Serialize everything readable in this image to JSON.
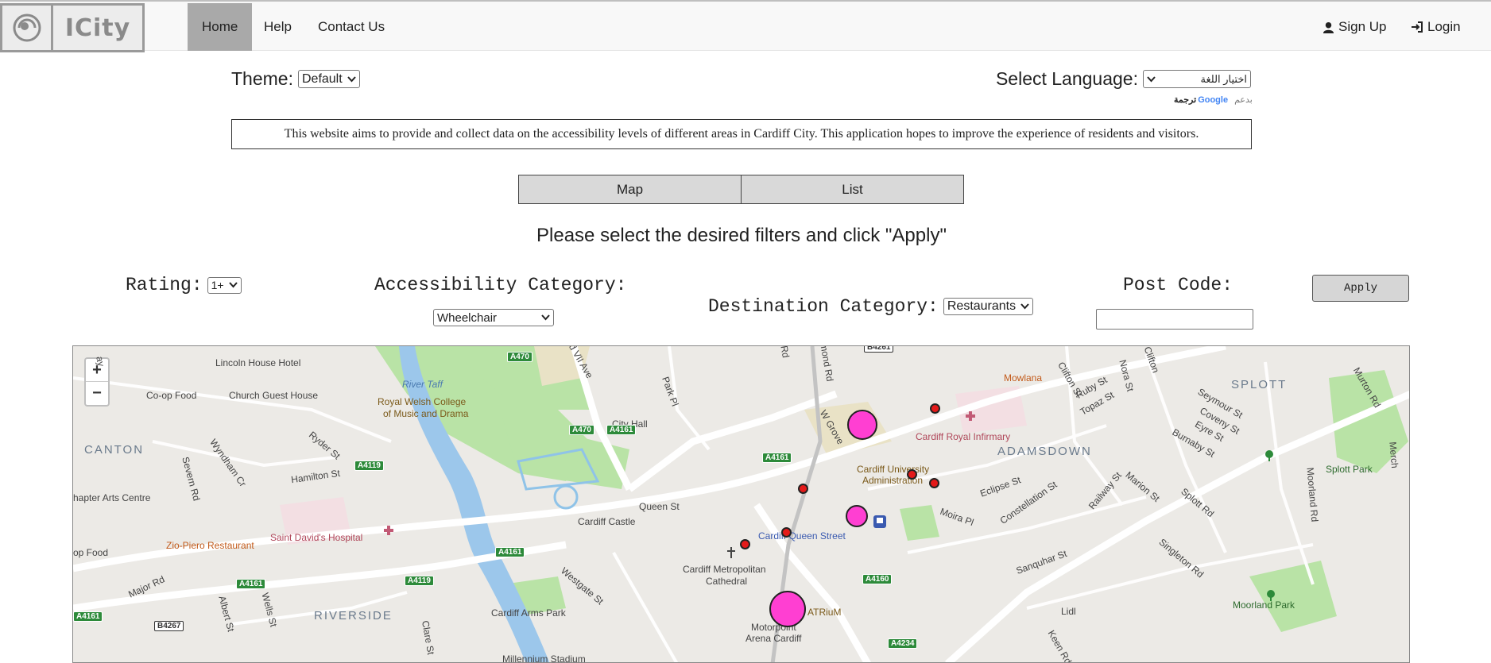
{
  "nav": {
    "logo_text": "ICity",
    "items": [
      {
        "label": "Home",
        "active": true
      },
      {
        "label": "Help"
      },
      {
        "label": "Contact Us"
      }
    ],
    "signup": "Sign Up",
    "login": "Login"
  },
  "theme": {
    "label": "Theme:",
    "value": "Default"
  },
  "language": {
    "label": "Select Language:",
    "value": "اختيار اللغة",
    "powered": "بدعم",
    "google": "Google",
    "translate": "ترجمة"
  },
  "banner": "This website aims to provide and collect data on the accessibility levels of different areas in Cardiff City. This application hopes to improve the experience of residents and visitors.",
  "view_toggle": {
    "map": "Map",
    "list": "List"
  },
  "instructions": "Please select the desired filters and click \"Apply\"",
  "filters": {
    "rating_label": "Rating:",
    "rating_value": "1+",
    "accessibility_label": "Accessibility Category:",
    "accessibility_value": "Wheelchair",
    "destination_label": "Destination Category:",
    "destination_value": "Restaurants",
    "postcode_label": "Post Code:",
    "postcode_value": "",
    "apply": "Apply"
  },
  "map": {
    "zoom_in": "+",
    "zoom_out": "−",
    "areas": [
      "CANTON",
      "RIVERSIDE",
      "ADAMSDOWN",
      "SPLOTT"
    ],
    "places": {
      "lincoln": "Lincoln House Hotel",
      "coop": "Co-op Food",
      "church": "Church Guest House",
      "chapter": "hapter Arts Centre",
      "zio": "Zio-Piero Restaurant",
      "stdavids": "Saint David's Hospital",
      "coop2": "op Food",
      "rwcmd1": "Royal Welsh College",
      "rwcmd2": "of Music and Drama",
      "cityhall": "City Hall",
      "rivertaff": "River Taff",
      "castle": "Cardiff Castle",
      "armspark": "Cardiff Arms Park",
      "millennium": "Millennium Stadium",
      "metro1": "Cardiff Metropolitan",
      "metro2": "Cathedral",
      "queenst_station": "Cardiff Queen Street",
      "motorpoint1": "Motorpoint",
      "motorpoint2": "Arena Cardiff",
      "atrium": "ATRiuM",
      "uni1": "Cardiff University",
      "uni2": "Administration",
      "infirmary": "Cardiff Royal Infirmary",
      "mowlana": "Mowlana",
      "splottpark": "Splott Park",
      "moorland": "Moorland Park",
      "lidl": "Lidl"
    },
    "streets": {
      "queen": "Queen St",
      "hamilton": "Hamilton St",
      "ryder": "Ryder St",
      "wyndham": "Wyndham Cr",
      "severn": "Severn Rd",
      "major": "Major Rd",
      "albert": "Albert St",
      "wells": "Wells St",
      "clare": "Clare St",
      "westgate": "Westgate St",
      "park": "Park Pl",
      "edward": "rd VII Ave",
      "moira": "Moira Pl",
      "eclipse": "Eclipse St",
      "constellation": "Constellation St",
      "railway": "Railway St",
      "marion": "Marion St",
      "splottrd": "Splott Rd",
      "sanquhar": "Sanquhar St",
      "singleton": "Singleton Rd",
      "moorlandrd": "Moorland Rd",
      "clifton": "Clifton St",
      "ruby": "Ruby St",
      "topaz": "Topaz St",
      "nora": "Nora St",
      "seymour": "Seymour St",
      "coveny": "Coveny St",
      "eyre": "Eyre St",
      "burnaby": "Burnaby St",
      "murton": "Murton Rd",
      "wgrove": "W Grove",
      "keen": "Keen Rd",
      "merch": "Merch",
      "richmond": "hmond Rd",
      "ay": "ay",
      "rd": "Rd",
      "clifton2": "Clifton"
    },
    "road_tags": [
      "A470",
      "A470",
      "A4161",
      "A4119",
      "A4161",
      "A4119",
      "A4161",
      "A4161",
      "B4267",
      "A4161",
      "A4160",
      "A4234",
      "B4261"
    ]
  }
}
